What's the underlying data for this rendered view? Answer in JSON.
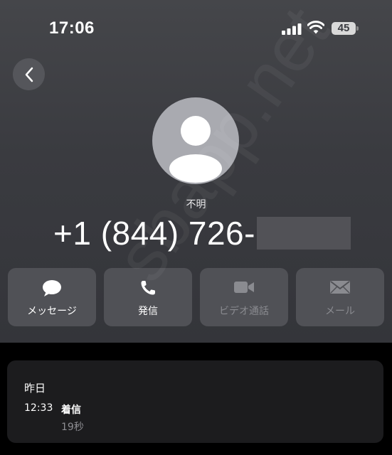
{
  "status_bar": {
    "time": "17:06",
    "battery": "45"
  },
  "contact": {
    "label": "不明",
    "phone_number": "+1 (844) 726-"
  },
  "actions": [
    {
      "label": "メッセージ",
      "icon": "message-bubble-icon",
      "enabled": true
    },
    {
      "label": "発信",
      "icon": "phone-icon",
      "enabled": true
    },
    {
      "label": "ビデオ通話",
      "icon": "video-camera-icon",
      "enabled": false
    },
    {
      "label": "メール",
      "icon": "envelope-icon",
      "enabled": false
    }
  ],
  "recents": {
    "date": "昨日",
    "calls": [
      {
        "time": "12:33",
        "type": "着信",
        "duration": "19秒"
      }
    ]
  },
  "watermark": "sbapp.net",
  "colors": {
    "header_bg": "#3a3b40",
    "button_bg": "#505156",
    "card_bg": "#1c1c1e",
    "disabled_text": "#8a8b90"
  }
}
